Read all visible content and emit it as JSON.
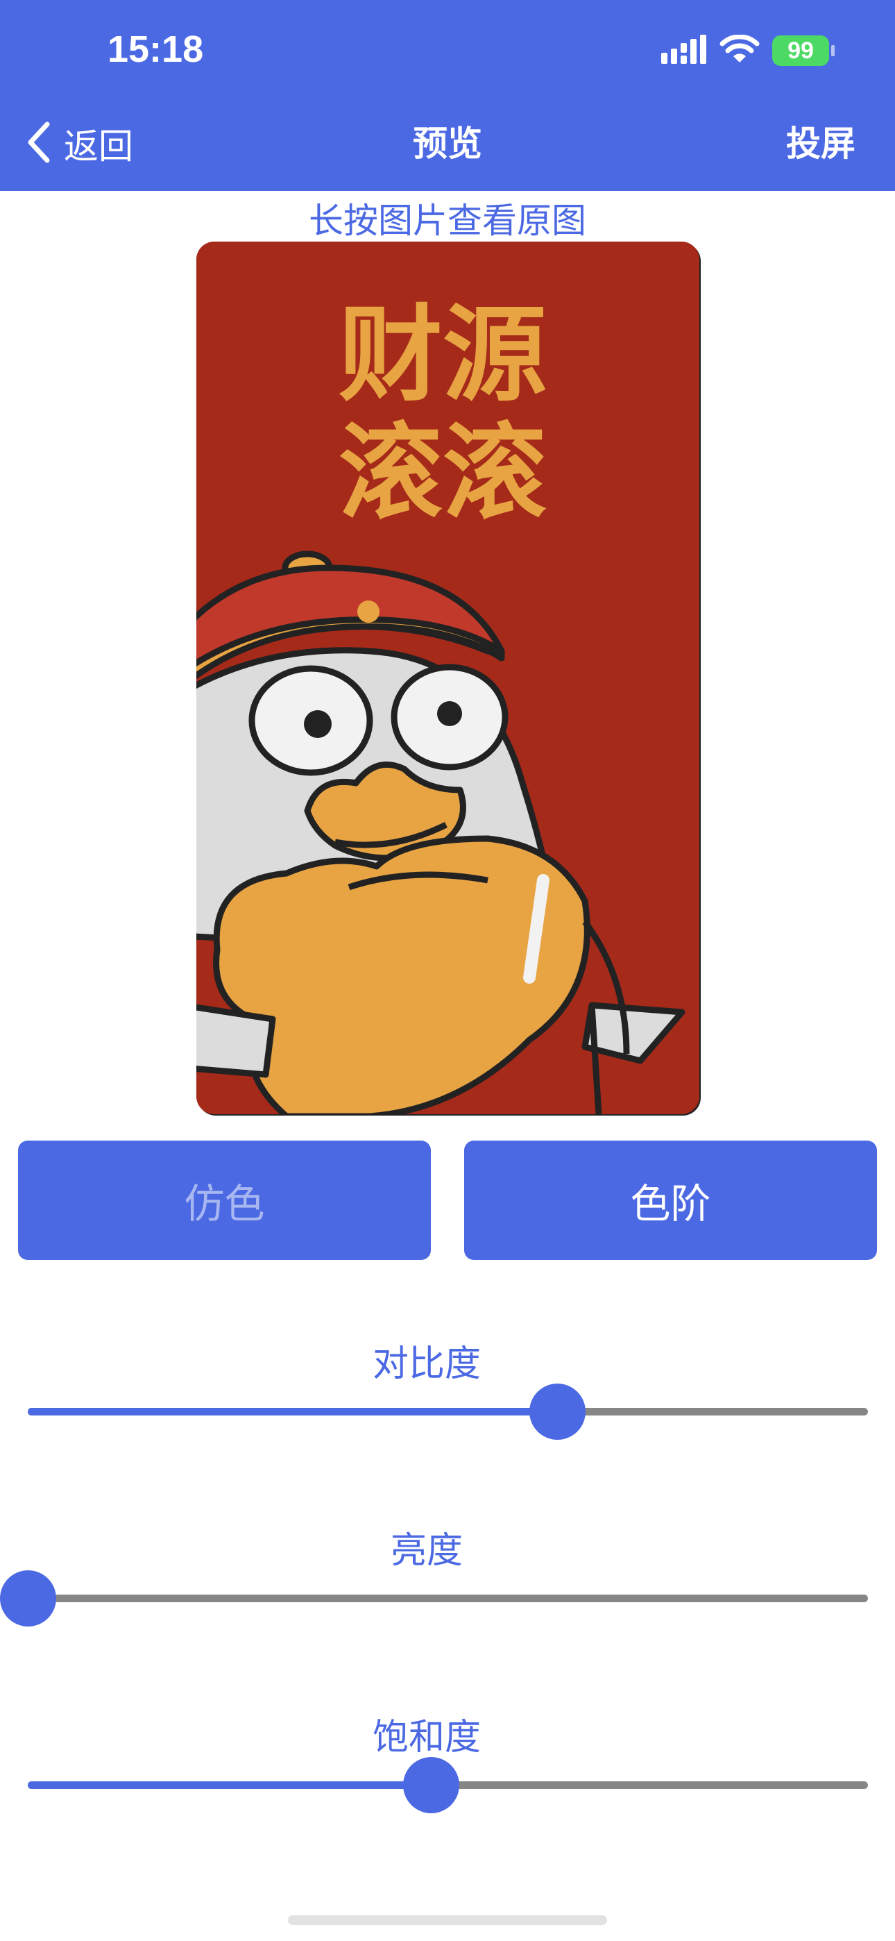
{
  "status_bar": {
    "time": "15:18",
    "battery": "99"
  },
  "nav": {
    "back_label": "返回",
    "title": "预览",
    "cast_label": "投屏"
  },
  "hint": "长按图片查看原图",
  "preview_image": {
    "text_line1": "财源",
    "text_line2": "滚滚",
    "background_color": "#a52a1a",
    "text_color": "#e8a443"
  },
  "mode_buttons": {
    "dither_label": "仿色",
    "levels_label": "色阶"
  },
  "sliders": [
    {
      "label": "对比度",
      "value": 0.63
    },
    {
      "label": "亮度",
      "value": 0.0
    },
    {
      "label": "饱和度",
      "value": 0.48
    }
  ],
  "colors": {
    "accent": "#4c69e4",
    "track": "#868686",
    "battery": "#4cd964"
  }
}
